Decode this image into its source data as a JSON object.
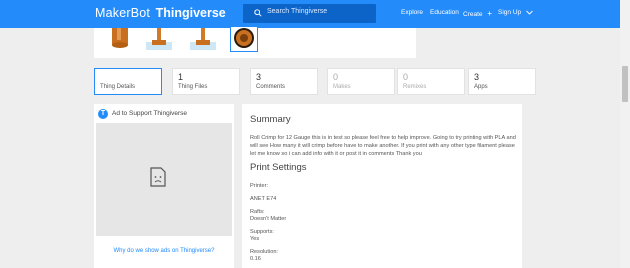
{
  "header": {
    "logo_left": "MakerBot",
    "logo_right": "Thingiverse",
    "search_placeholder": "Search Thingiverse",
    "nav": {
      "explore": "Explore",
      "education": "Education",
      "create": "Create",
      "create_icon": "+",
      "signup": "Sign Up",
      "signup_icon": "chevron-down"
    },
    "accent": "#248bfb"
  },
  "tabs": [
    {
      "count": "",
      "label": "Thing Details",
      "active": true
    },
    {
      "count": "1",
      "label": "Thing Files"
    },
    {
      "count": "3",
      "label": "Comments"
    },
    {
      "count": "0",
      "label": "Makes",
      "dim": true
    },
    {
      "count": "0",
      "label": "Remixes",
      "dim": true
    },
    {
      "count": "3",
      "label": "Apps"
    }
  ],
  "ad": {
    "title": "Ad to Support Thingiverse",
    "link": "Why do we show ads on Thingiverse?"
  },
  "summary": {
    "heading": "Summary",
    "lines": [
      "Roll Crimp for 12 Gauge this is in test so please feel free to help improve. Going to try printing with PLA and",
      "will see How many it will crimp before have to make another. If you print with any other type filament please",
      "let me know so i can add info with it or post it in comments Thank you"
    ]
  },
  "print_settings": {
    "heading": "Print Settings",
    "printer_label": "Printer:",
    "printer_value": "ANET E74",
    "rafts_label": "Rafts:",
    "rafts_value": "Doesn't Matter",
    "supports_label": "Supports:",
    "supports_value": "Yes",
    "resolution_label": "Resolution:",
    "resolution_value": "0.16"
  }
}
